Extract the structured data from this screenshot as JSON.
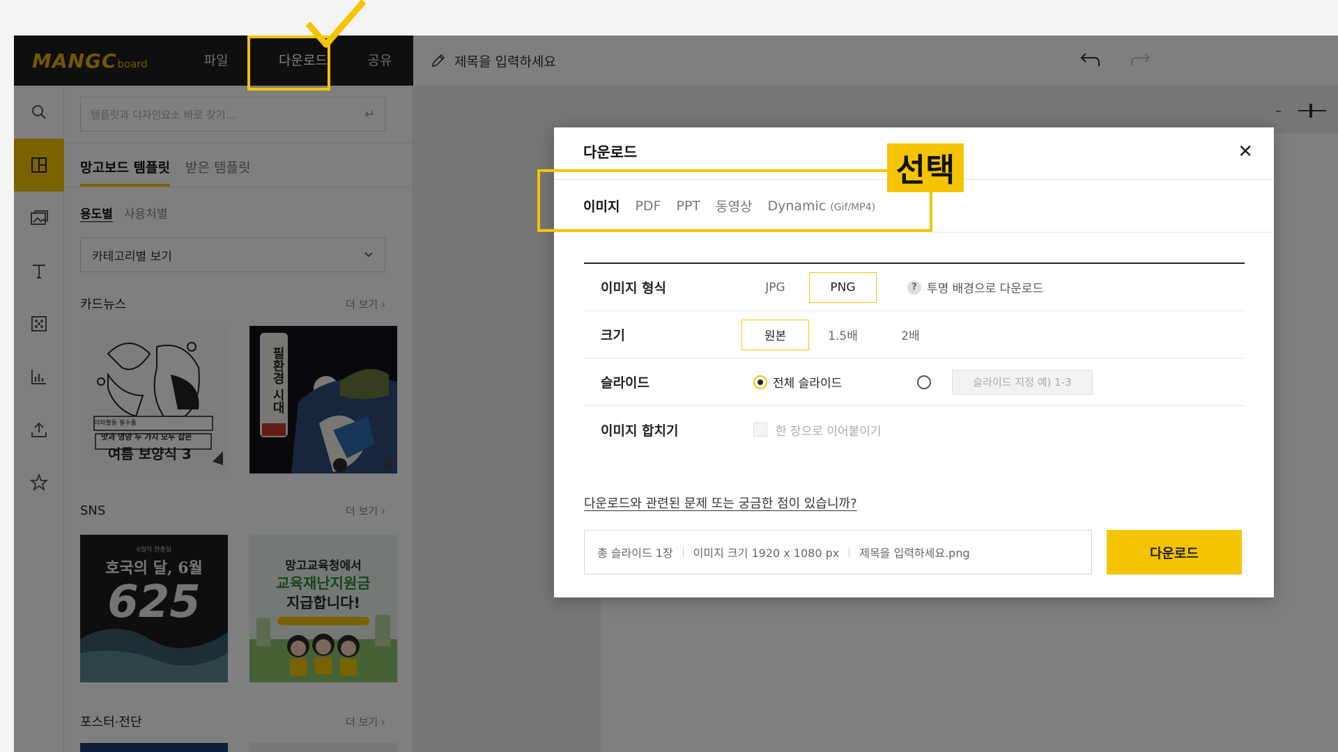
{
  "app": {
    "logo_main": "MANGC",
    "logo_sub": "board",
    "menu": [
      "파일",
      "다운로드",
      "공유"
    ],
    "title_placeholder": "제목을 입력하세요"
  },
  "panel": {
    "search_placeholder": "템플릿과 디자인요소 바로 찾기...",
    "tabs": [
      "망고보드 템플릿",
      "받은 템플릿"
    ],
    "subtabs": [
      "용도별",
      "사용처별"
    ],
    "category_select": "카테고리별 보기",
    "sections": [
      {
        "title": "카드뉴스",
        "more": "더 보기"
      },
      {
        "title": "SNS",
        "more": "더 보기"
      },
      {
        "title": "포스터·전단",
        "more": "더 보기"
      }
    ],
    "thumbs": {
      "card1_small": "야외활동 필수품",
      "card1_line": "맛과 영양 두 가지 모두 잡은",
      "card1_title": "여름 보양식 3",
      "card2_title": "필환경 시대",
      "sns1_top": "6월의 현충일",
      "sns1_title": "호국의 달, 6월",
      "sns1_num": "625",
      "sns2_line1": "망고교육청에서",
      "sns2_line2": "교육재난지원금",
      "sns2_line3": "지급합니다!"
    }
  },
  "modal": {
    "title": "다운로드",
    "tabs": [
      "이미지",
      "PDF",
      "PPT",
      "동영상",
      "Dynamic"
    ],
    "dynamic_suffix": "(Gif/MP4)",
    "rows": {
      "format": {
        "label": "이미지 형식",
        "options": [
          "JPG",
          "PNG"
        ],
        "selected": "PNG",
        "help": "투명 배경으로 다운로드"
      },
      "size": {
        "label": "크기",
        "options": [
          "원본",
          "1.5배",
          "2배"
        ],
        "selected": "원본"
      },
      "slide": {
        "label": "슬라이드",
        "all": "전체 슬라이드",
        "range_placeholder": "슬라이드 지정 예) 1-3"
      },
      "merge": {
        "label": "이미지 합치기",
        "checkbox": "한 장으로 이어붙이기"
      }
    },
    "faq": "다운로드와 관련된 문제 또는 궁금한 점이 있습니까?",
    "summary": [
      "총 슬라이드 1장",
      "이미지 크기 1920 x 1080 px",
      "제목을 입력하세요.png"
    ],
    "download_button": "다운로드"
  },
  "annotation": {
    "label": "선택",
    "color": "#f5c400"
  },
  "colors": {
    "accent": "#f5c400",
    "dark_bar": "#1f1f1f"
  }
}
